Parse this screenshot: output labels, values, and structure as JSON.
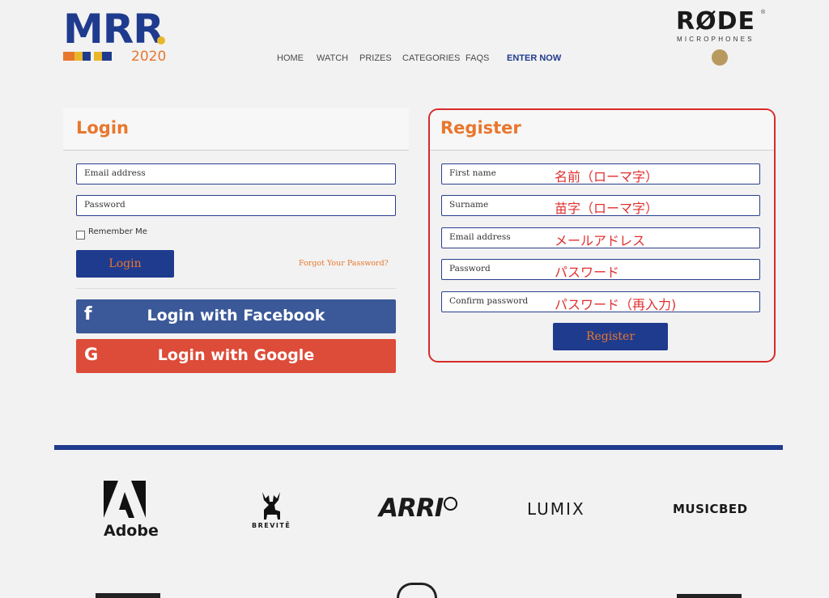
{
  "header": {
    "brand": "MRR",
    "brand_dot": ".",
    "year": "2020",
    "partner": "RØDE",
    "partner_sub": "MICROPHONES",
    "partner_reg": "®",
    "nav": [
      "HOME",
      "WATCH",
      "PRIZES",
      "CATEGORIES",
      "FAQS",
      "ENTER NOW"
    ]
  },
  "login": {
    "title": "Login",
    "email_placeholder": "Email address",
    "password_placeholder": "Password",
    "remember_label": "Remember Me",
    "submit_label": "Login",
    "forgot_label": "Forgot Your Password?",
    "facebook_label": "Login with Facebook",
    "facebook_icon": "f",
    "google_label": "Login with Google",
    "google_icon": "G"
  },
  "register": {
    "title": "Register",
    "fields": [
      {
        "placeholder": "First name",
        "annotation": "名前（ローマ字）"
      },
      {
        "placeholder": "Surname",
        "annotation": "苗字（ローマ字）"
      },
      {
        "placeholder": "Email address",
        "annotation": "メールアドレス"
      },
      {
        "placeholder": "Password",
        "annotation": "パスワード"
      },
      {
        "placeholder": "Confirm password",
        "annotation": "パスワード（再入力)"
      }
    ],
    "submit_label": "Register"
  },
  "sponsors": [
    "Adobe",
    "BREVITĒ",
    "ARRI",
    "LUMIX",
    "MUSICBED"
  ],
  "colors": {
    "navy": "#1f3b8e",
    "orange": "#e8772e",
    "facebook": "#3b5998",
    "google": "#dd4b39",
    "annotation_red": "#d92a2a"
  }
}
